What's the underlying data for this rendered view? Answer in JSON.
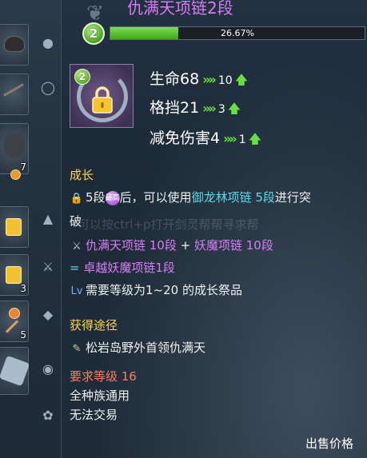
{
  "inventory": {
    "slots": [
      {
        "icon": "hat-icon",
        "count": ""
      },
      {
        "icon": "twig-icon",
        "count": ""
      },
      {
        "icon": "leaf-bundle-icon",
        "count": "7"
      },
      {
        "icon": "locked-item-icon",
        "count": ""
      },
      {
        "icon": "locked-item-icon",
        "count": "3"
      },
      {
        "icon": "gem-staff-icon",
        "count": "5"
      },
      {
        "icon": "crystal-icon",
        "count": ""
      }
    ]
  },
  "tooltip": {
    "title": "仇满天项链2段",
    "level": "2",
    "progress": {
      "value": 0.2667,
      "label": "26.67%"
    },
    "item_level": "2",
    "stats": [
      {
        "label": "生命68",
        "chevrons": "»»",
        "increase": "10"
      },
      {
        "label": "格挡21",
        "chevrons": "»»",
        "increase": "3"
      },
      {
        "label": "减免伤害4",
        "chevrons": "»»",
        "increase": "1"
      }
    ],
    "growth": {
      "heading": "成长",
      "line1_a": "5段",
      "line1_badge": "最高",
      "line1_b": "后，可以使用",
      "line1_link": "御龙林项链 5段",
      "line1_c": "进行突",
      "line2": "破",
      "formula_item1": "仇满天项链 10段",
      "formula_plus": " + ",
      "formula_item2": "妖魔项链 10段",
      "formula_eq": "= ",
      "formula_result": "卓越妖魔项链1段",
      "req_text": "需要等级为1~20 的成长祭品"
    },
    "acquire": {
      "heading": "获得途径",
      "source": "松岩岛野外首领仇满天"
    },
    "requirement": {
      "text": "要求等级 16"
    },
    "race": "全种族通用",
    "trade": "无法交易",
    "watermark": "可以按ctrl+p打开剑灵帮帮寻求帮",
    "sell_label": "出售价格"
  }
}
